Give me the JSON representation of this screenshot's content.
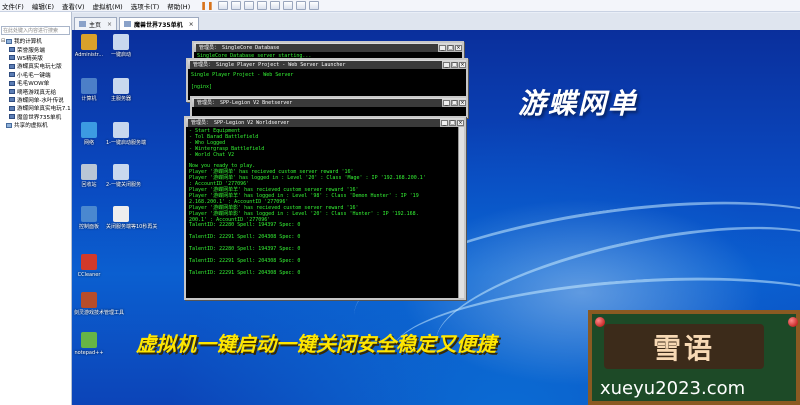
{
  "menubar": {
    "items": [
      "文件(F)",
      "编辑(E)",
      "查看(V)",
      "虚拟机(M)",
      "选项卡(T)",
      "帮助(H)"
    ]
  },
  "library": {
    "search_placeholder": "在此处键入内容进行搜索",
    "tree": [
      {
        "label": "我的计算机",
        "level": 0,
        "kind": "computer",
        "twisty": "⊟"
      },
      {
        "label": "荣誉服务端",
        "level": 1,
        "kind": "vm"
      },
      {
        "label": "WS精英版",
        "level": 1,
        "kind": "vm"
      },
      {
        "label": "游蝶真实电玩七版",
        "level": 1,
        "kind": "vm"
      },
      {
        "label": "小毛毛一键端",
        "level": 1,
        "kind": "vm"
      },
      {
        "label": "毛毛WOW单",
        "level": 1,
        "kind": "vm"
      },
      {
        "label": "嘀嗒游戏真无给",
        "level": 1,
        "kind": "vm"
      },
      {
        "label": "游蝶网单-水叶传说",
        "level": 1,
        "kind": "vm"
      },
      {
        "label": "游蝶网单真实电玩7.18",
        "level": 1,
        "kind": "vm"
      },
      {
        "label": "魔兽世界735单机",
        "level": 1,
        "kind": "vm"
      },
      {
        "label": "共享的虚拟机",
        "level": 0,
        "kind": "computer",
        "twisty": ""
      }
    ]
  },
  "tabs": [
    {
      "label": "主页",
      "active": false
    },
    {
      "label": "魔兽世界735单机",
      "active": true
    }
  ],
  "desktop": {
    "title": "游蝶网单",
    "slogan": "虚拟机一键启动一键关闭安全稳定又便捷",
    "icons": [
      {
        "label": "Administr...",
        "color": "#d9a12b"
      },
      {
        "label": "一键启动",
        "color": "#c8d8ee"
      },
      {
        "label": "计算机",
        "color": "#4c7fc8"
      },
      {
        "label": "主服务器",
        "color": "#c8d8ee"
      },
      {
        "label": "网络",
        "color": "#3c9be2"
      },
      {
        "label": "1-一键启动服务端",
        "color": "#c8d8ee"
      },
      {
        "label": "回收站",
        "color": "#b9c6d6"
      },
      {
        "label": "2-一键关闭服务",
        "color": "#c8d8ee"
      },
      {
        "label": "控制面板",
        "color": "#4a88d0"
      },
      {
        "label": "关闭服务端等10秒再关",
        "color": "#eeeeee"
      },
      {
        "label": "CCleaner",
        "color": "#d23a2a"
      },
      {
        "label": "剑灵游戏技术管理工具",
        "color": "#b84d2a"
      },
      {
        "label": "notepad++",
        "color": "#66b545"
      }
    ]
  },
  "consoles": {
    "db": {
      "title": "管理员： SingleCore Database",
      "line": "SingleCore Database server starting..."
    },
    "web": {
      "title": "管理员： Single Player Project - Web Server Launcher",
      "lines": [
        "Single Player Project - Web Server",
        "",
        "[nginx]"
      ]
    },
    "battle": {
      "title": "管理员： SPP-Legion V2 Bnetserver"
    },
    "world": {
      "title": "管理员： SPP-Legion V2 Worldserver",
      "lines": [
        "- Start Equipment",
        "- Tol Barad Battlefield",
        "- Who Logged",
        "- Wintergrasp Battlefield",
        "- World Chat V2",
        "",
        "Now you ready to play.",
        "Player '游蝶网单' has recieved custom server reward '16'",
        "Player '游蝶网单' has logged in : Level '20' : Class 'Mage' : IP '192.168.200.1'",
        ": AccountID '277096'",
        "Player '游蝶网单羊' has recieved custom server reward '16'",
        "Player '游蝶网单羊' has logged in : Level '98' : Class 'Demon Hunter' : IP '19",
        "2.168.200.1' : AccountID '277096'",
        "Player '游蝶网单影' has recieved custom server reward '16'",
        "Player '游蝶网单影' has logged in : Level '20' : Class 'Hunter' : IP '192.168.",
        "200.1' : AccountID '277096'",
        "TalentID: 22280 Spell: 194397 Spec: 0",
        "",
        "TalentID: 22291 Spell: 204308 Spec: 0",
        "",
        "TalentID: 22280 Spell: 194397 Spec: 0",
        "",
        "TalentID: 22291 Spell: 204308 Spec: 0",
        "",
        "TalentID: 22291 Spell: 204308 Spec: 0"
      ]
    }
  },
  "watermark": {
    "logo": "雪语",
    "url": "xueyu2023.com"
  }
}
